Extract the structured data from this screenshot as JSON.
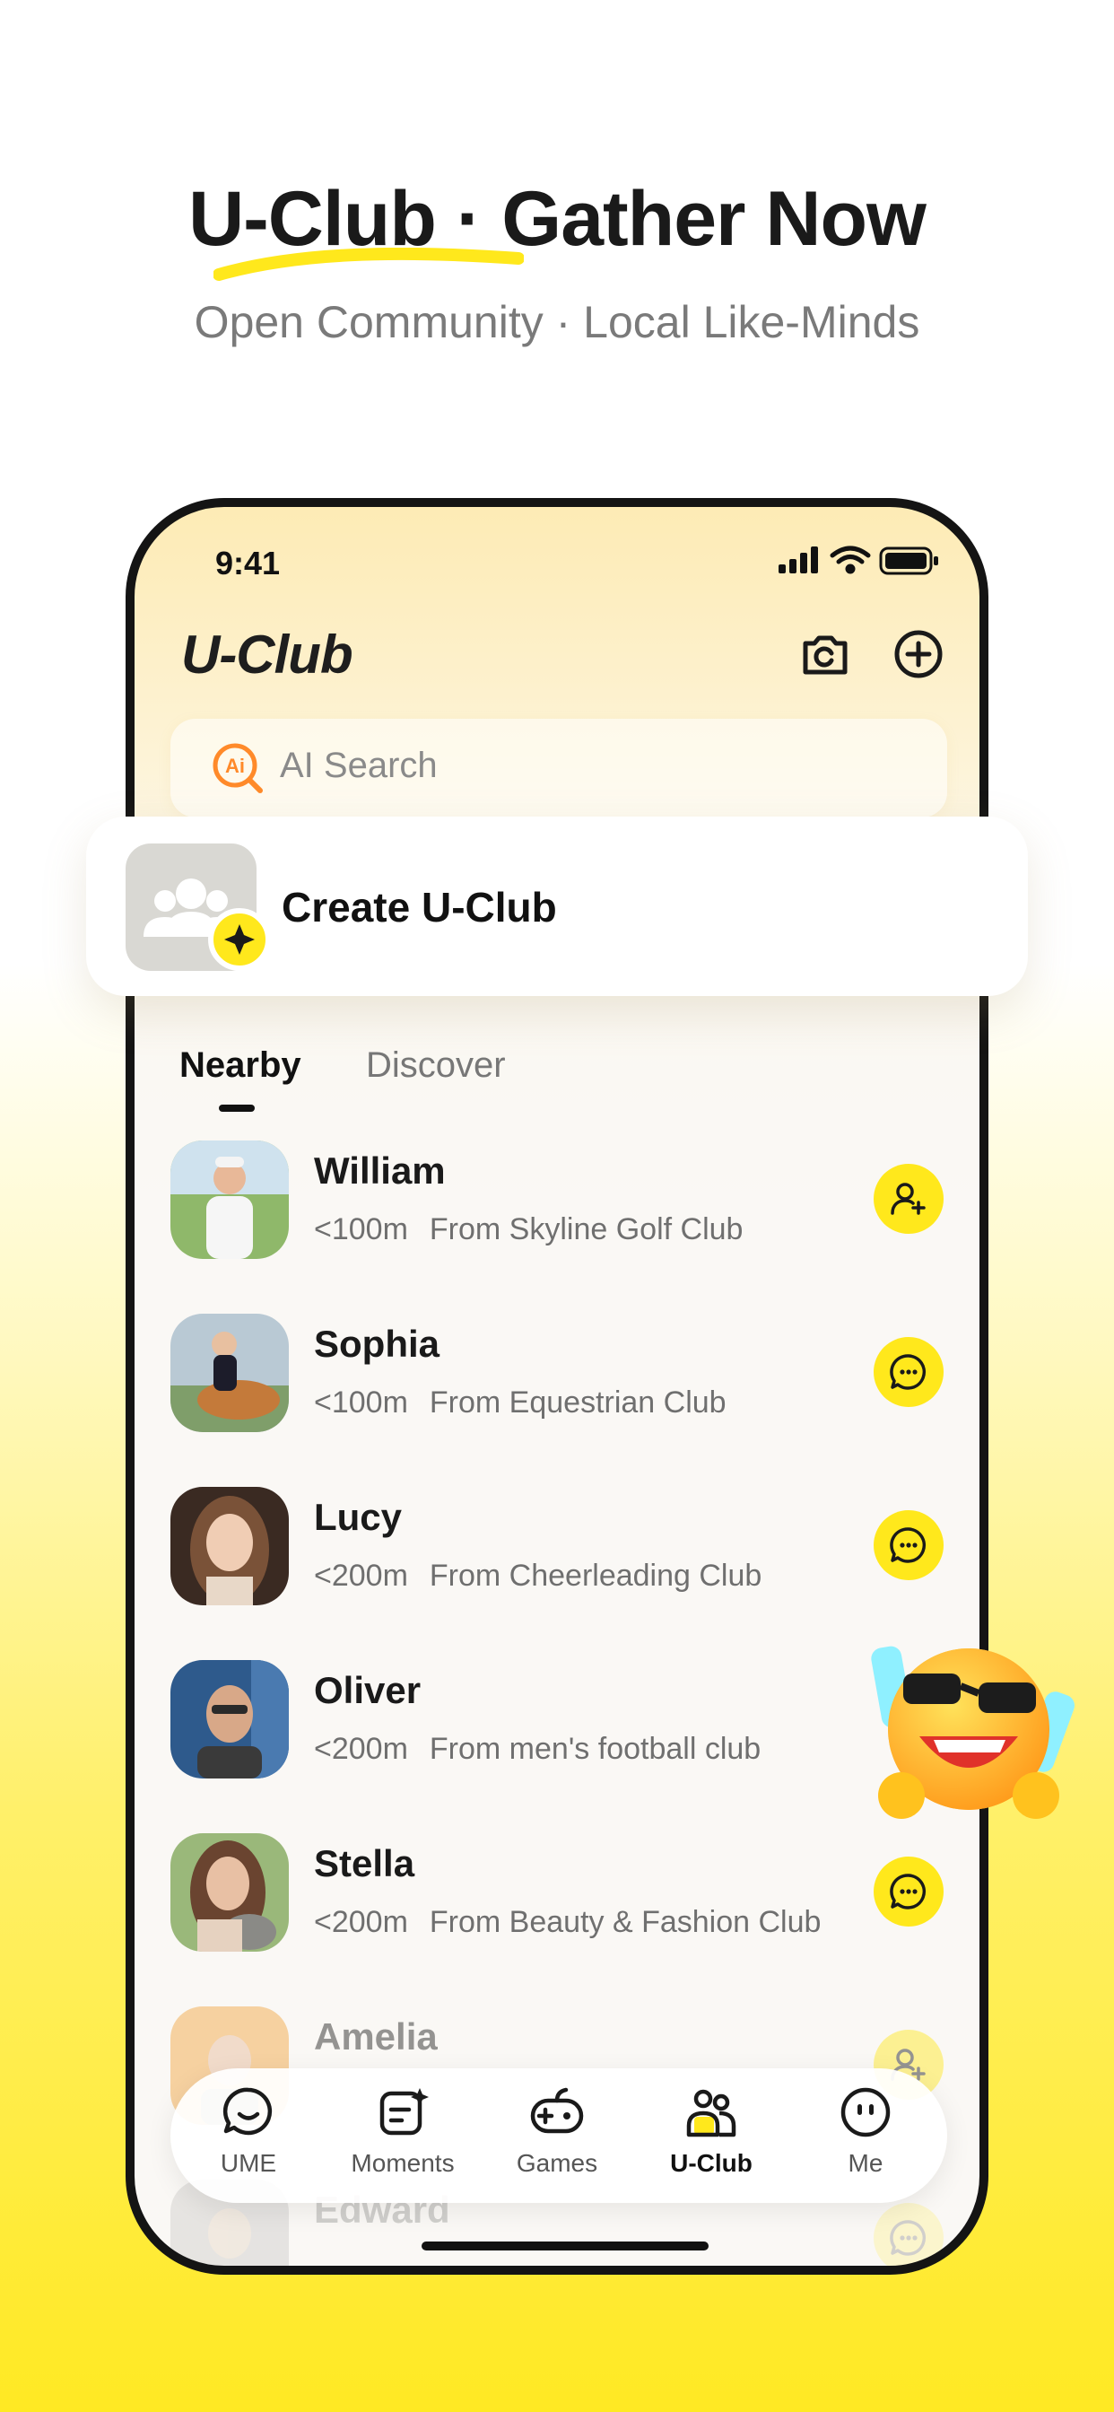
{
  "hero": {
    "title": "U-Club · Gather Now",
    "subtitle": "Open Community · Local Like-Minds",
    "accent_color": "#ffe81c"
  },
  "status_bar": {
    "time": "9:41"
  },
  "header": {
    "title": "U-Club",
    "camera_icon": "camera-icon",
    "add_icon": "plus-circle-icon"
  },
  "search": {
    "placeholder": "AI Search",
    "icon": "ai-search-icon"
  },
  "create_card": {
    "label": "Create U-Club",
    "icon": "group-icon",
    "badge_icon": "sparkle-icon"
  },
  "tabs": [
    {
      "label": "Nearby",
      "active": true
    },
    {
      "label": "Discover",
      "active": false
    }
  ],
  "people": [
    {
      "name": "William",
      "distance": "<100m",
      "source": "From Skyline Golf Club",
      "action": "add-friend-icon"
    },
    {
      "name": "Sophia",
      "distance": "<100m",
      "source": "From Equestrian Club",
      "action": "chat-icon"
    },
    {
      "name": "Lucy",
      "distance": "<200m",
      "source": "From Cheerleading Club",
      "action": "chat-icon"
    },
    {
      "name": "Oliver",
      "distance": "<200m",
      "source": "From men's football club",
      "action": ""
    },
    {
      "name": "Stella",
      "distance": "<200m",
      "source": "From Beauty & Fashion Club",
      "action": "chat-icon"
    },
    {
      "name": "Amelia",
      "distance": "",
      "source": "",
      "action": "add-friend-icon"
    },
    {
      "name": "Edward",
      "distance": "",
      "source": "",
      "action": "chat-icon"
    }
  ],
  "bottom_nav": [
    {
      "label": "UME",
      "icon": "smile-chat-icon",
      "active": false
    },
    {
      "label": "Moments",
      "icon": "moments-icon",
      "active": false
    },
    {
      "label": "Games",
      "icon": "gamepad-icon",
      "active": false
    },
    {
      "label": "U-Club",
      "icon": "club-icon",
      "active": true
    },
    {
      "label": "Me",
      "icon": "face-icon",
      "active": false
    }
  ]
}
